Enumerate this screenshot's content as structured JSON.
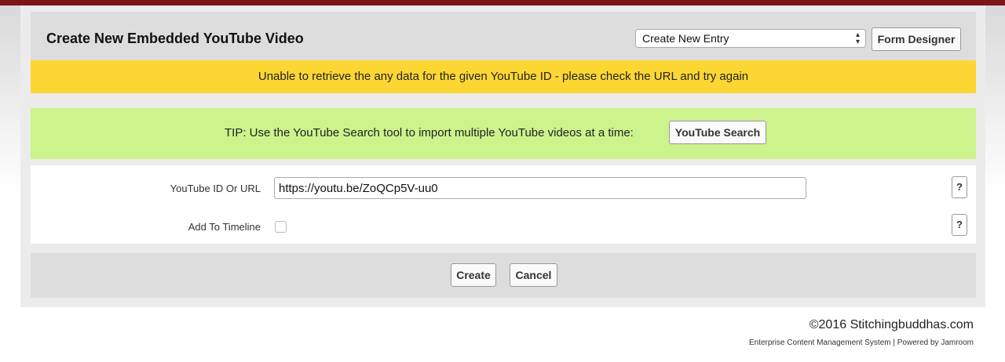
{
  "header": {
    "title": "Create New Embedded YouTube Video",
    "select_value": "Create New Entry",
    "form_designer_label": "Form Designer"
  },
  "notice": {
    "error_text": "Unable to retrieve the any data for the given YouTube ID - please check the URL and try again",
    "tip_text": "TIP: Use the YouTube Search tool to import multiple YouTube videos at a time:",
    "youtube_search_label": "YouTube Search"
  },
  "form": {
    "youtube_label": "YouTube ID Or URL",
    "youtube_value": "https://youtu.be/ZoQCp5V-uu0",
    "timeline_label": "Add To Timeline",
    "timeline_checked": false,
    "help_label": "?"
  },
  "actions": {
    "create_label": "Create",
    "cancel_label": "Cancel"
  },
  "footer": {
    "copyright": "©2016 Stitchingbuddhas.com",
    "powered_by": "Enterprise Content Management System | Powered by Jamroom"
  },
  "colors": {
    "top_bar": "#7c1418",
    "error_bg": "#fcd733",
    "tip_bg": "#ccf38c"
  },
  "icons": {
    "select_chevron": "up-down-chevron-icon"
  }
}
